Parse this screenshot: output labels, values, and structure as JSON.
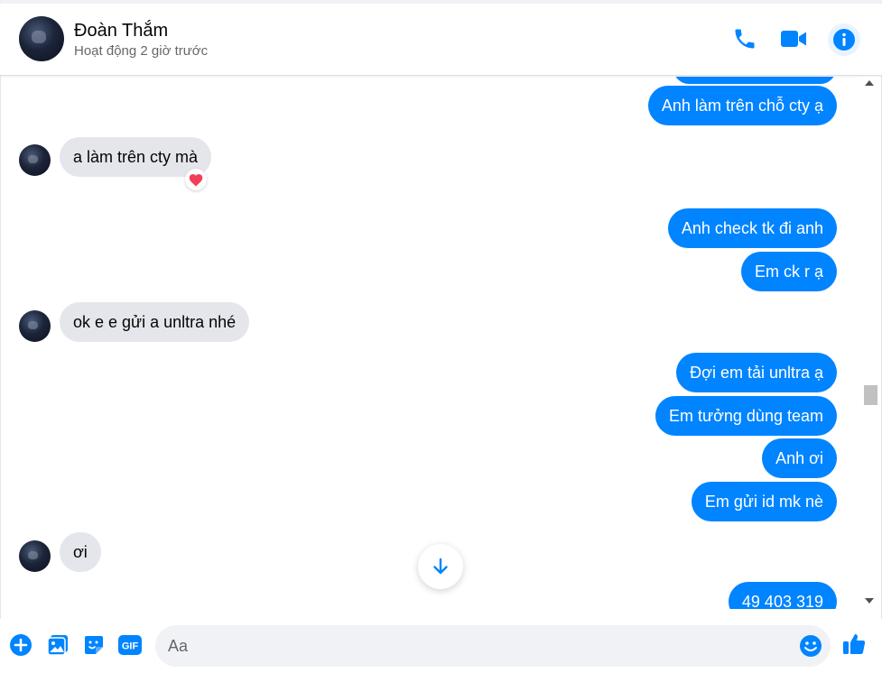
{
  "header": {
    "name": "Đoàn Thắm",
    "status": "Hoạt động 2 giờ trước",
    "icons": [
      "phone-icon",
      "video-camera-icon",
      "info-icon"
    ]
  },
  "colors": {
    "accent": "#0084ff",
    "incoming_bubble": "#e4e6eb",
    "reaction_heart": "#f33e58"
  },
  "messages": [
    {
      "from": "me",
      "text": "Anh làm trên chỗ cty ạ"
    },
    {
      "from": "them",
      "text": "a làm trên cty mà",
      "reaction": "heart"
    },
    {
      "from": "me",
      "text": "Anh check tk đi anh"
    },
    {
      "from": "me",
      "text": "Em ck r ạ"
    },
    {
      "from": "them",
      "text": "ok e e gửi a unltra nhé"
    },
    {
      "from": "me",
      "text": "Đợi em tải unltra ạ"
    },
    {
      "from": "me",
      "text": "Em tưởng dùng team"
    },
    {
      "from": "me",
      "text": "Anh ơi"
    },
    {
      "from": "me",
      "text": "Em gửi id mk nè"
    },
    {
      "from": "them",
      "text": "ơi"
    },
    {
      "from": "me",
      "text": "49 403 319"
    }
  ],
  "composer": {
    "placeholder": "Aa",
    "icons": [
      "plus-icon",
      "image-icon",
      "sticker-icon",
      "gif-icon",
      "emoji-icon",
      "thumbs-up-icon"
    ],
    "gif_label": "GIF"
  }
}
